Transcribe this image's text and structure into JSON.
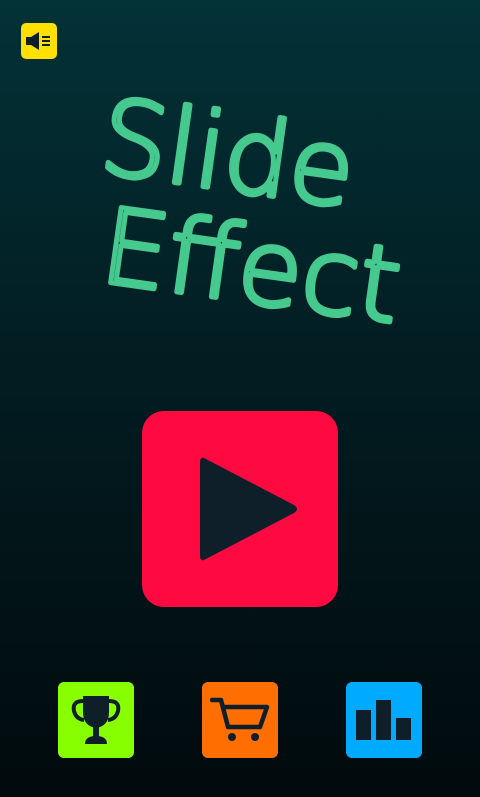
{
  "title": {
    "line1": "Slide",
    "line2": "Effect"
  },
  "colors": {
    "title_stroke": "#45c98e",
    "icon_dark": "#0f1f2a",
    "sound_bg": "#ffe000",
    "play_bg": "#ff0a40",
    "trophy_bg": "#88ff00",
    "cart_bg": "#ff6e00",
    "stats_bg": "#00aaff"
  },
  "icons": {
    "sound": "speaker-icon",
    "play": "play-icon",
    "trophy": "trophy-icon",
    "cart": "cart-icon",
    "stats": "bar-chart-icon"
  }
}
